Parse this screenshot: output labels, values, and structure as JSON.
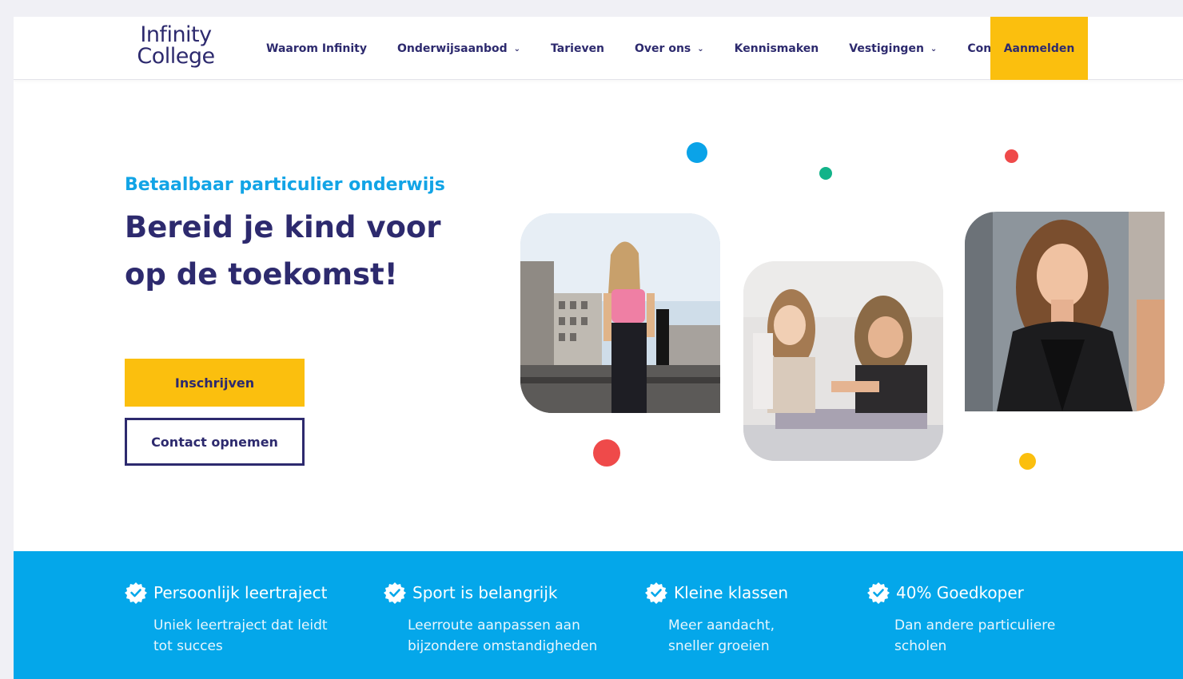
{
  "brand": {
    "logo_line1": "Infinity",
    "logo_line2": "College",
    "primary_color": "#2d2a6e",
    "accent_yellow": "#fbbf0e",
    "accent_blue": "#04a7ea"
  },
  "nav": {
    "items": [
      {
        "label": "Waarom Infinity",
        "dropdown": false
      },
      {
        "label": "Onderwijsaanbod",
        "dropdown": true
      },
      {
        "label": "Tarieven",
        "dropdown": false
      },
      {
        "label": "Over ons",
        "dropdown": true
      },
      {
        "label": "Kennismaken",
        "dropdown": false
      },
      {
        "label": "Vestigingen",
        "dropdown": true
      },
      {
        "label": "Contact",
        "dropdown": false
      }
    ],
    "cta_label": "Aanmelden",
    "chevron_icon": "chevron-down-icon"
  },
  "hero": {
    "subtitle": "Betaalbaar particulier onderwijs",
    "title_line1": "Bereid je kind voor",
    "title_line2": "op de toekomst!",
    "primary_button": "Inschrijven",
    "secondary_button": "Contact opnemen"
  },
  "features": [
    {
      "icon": "verified-badge-icon",
      "title": "Persoonlijk leertraject",
      "desc_line1": "Uniek leertraject dat leidt",
      "desc_line2": "tot succes"
    },
    {
      "icon": "verified-badge-icon",
      "title": "Sport is belangrijk",
      "desc_line1": "Leerroute aanpassen aan",
      "desc_line2": "bijzondere omstandigheden"
    },
    {
      "icon": "verified-badge-icon",
      "title": "Kleine klassen",
      "desc_line1": "Meer aandacht,",
      "desc_line2": "sneller groeien"
    },
    {
      "icon": "verified-badge-icon",
      "title": "40% Goedkoper",
      "desc_line1": "Dan andere particuliere",
      "desc_line2": "scholen"
    }
  ]
}
